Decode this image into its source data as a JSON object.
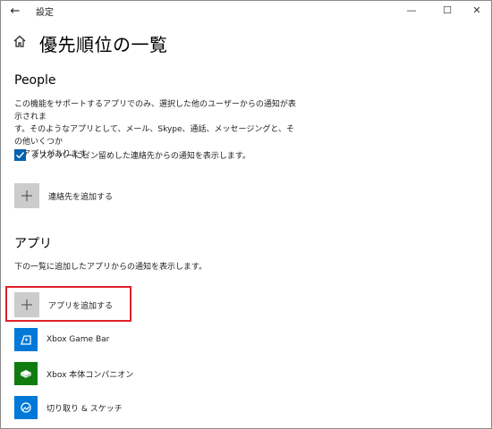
{
  "window": {
    "title": "設定",
    "back_glyph": "←",
    "minimize_glyph": "—",
    "maximize_glyph": "☐",
    "close_glyph": "✕"
  },
  "page": {
    "title": "優先順位の一覧",
    "home_icon": "home-icon"
  },
  "people": {
    "heading": "People",
    "description_lines": [
      "この機能をサポートするアプリでのみ、選択した他のユーザーからの通知が表示されま",
      "す。そのようなアプリとして、メール、Skype、通話、メッセージングと、その他いくつか",
      "のアプリがあります。"
    ],
    "checkbox_label": "タスク バーにピン留めした連絡先からの通知を表示します。",
    "checkbox_checked": true,
    "add_contact_label": "連絡先を追加する"
  },
  "apps": {
    "heading": "アプリ",
    "description": "下の一覧に追加したアプリからの通知を表示します。",
    "add_app_label": "アプリを追加する",
    "items": [
      {
        "label": "Xbox Game Bar",
        "icon": "xbox-game-bar-icon",
        "color": "#0078d7"
      },
      {
        "label": "Xbox 本体コンパニオン",
        "icon": "xbox-console-companion-icon",
        "color": "#107c10"
      },
      {
        "label": "切り取り & スケッチ",
        "icon": "snip-sketch-icon",
        "color": "#0078d7"
      }
    ]
  },
  "colors": {
    "accent": "#0063b1",
    "highlight": "#e0202a",
    "tile_gray": "#cccccc"
  }
}
